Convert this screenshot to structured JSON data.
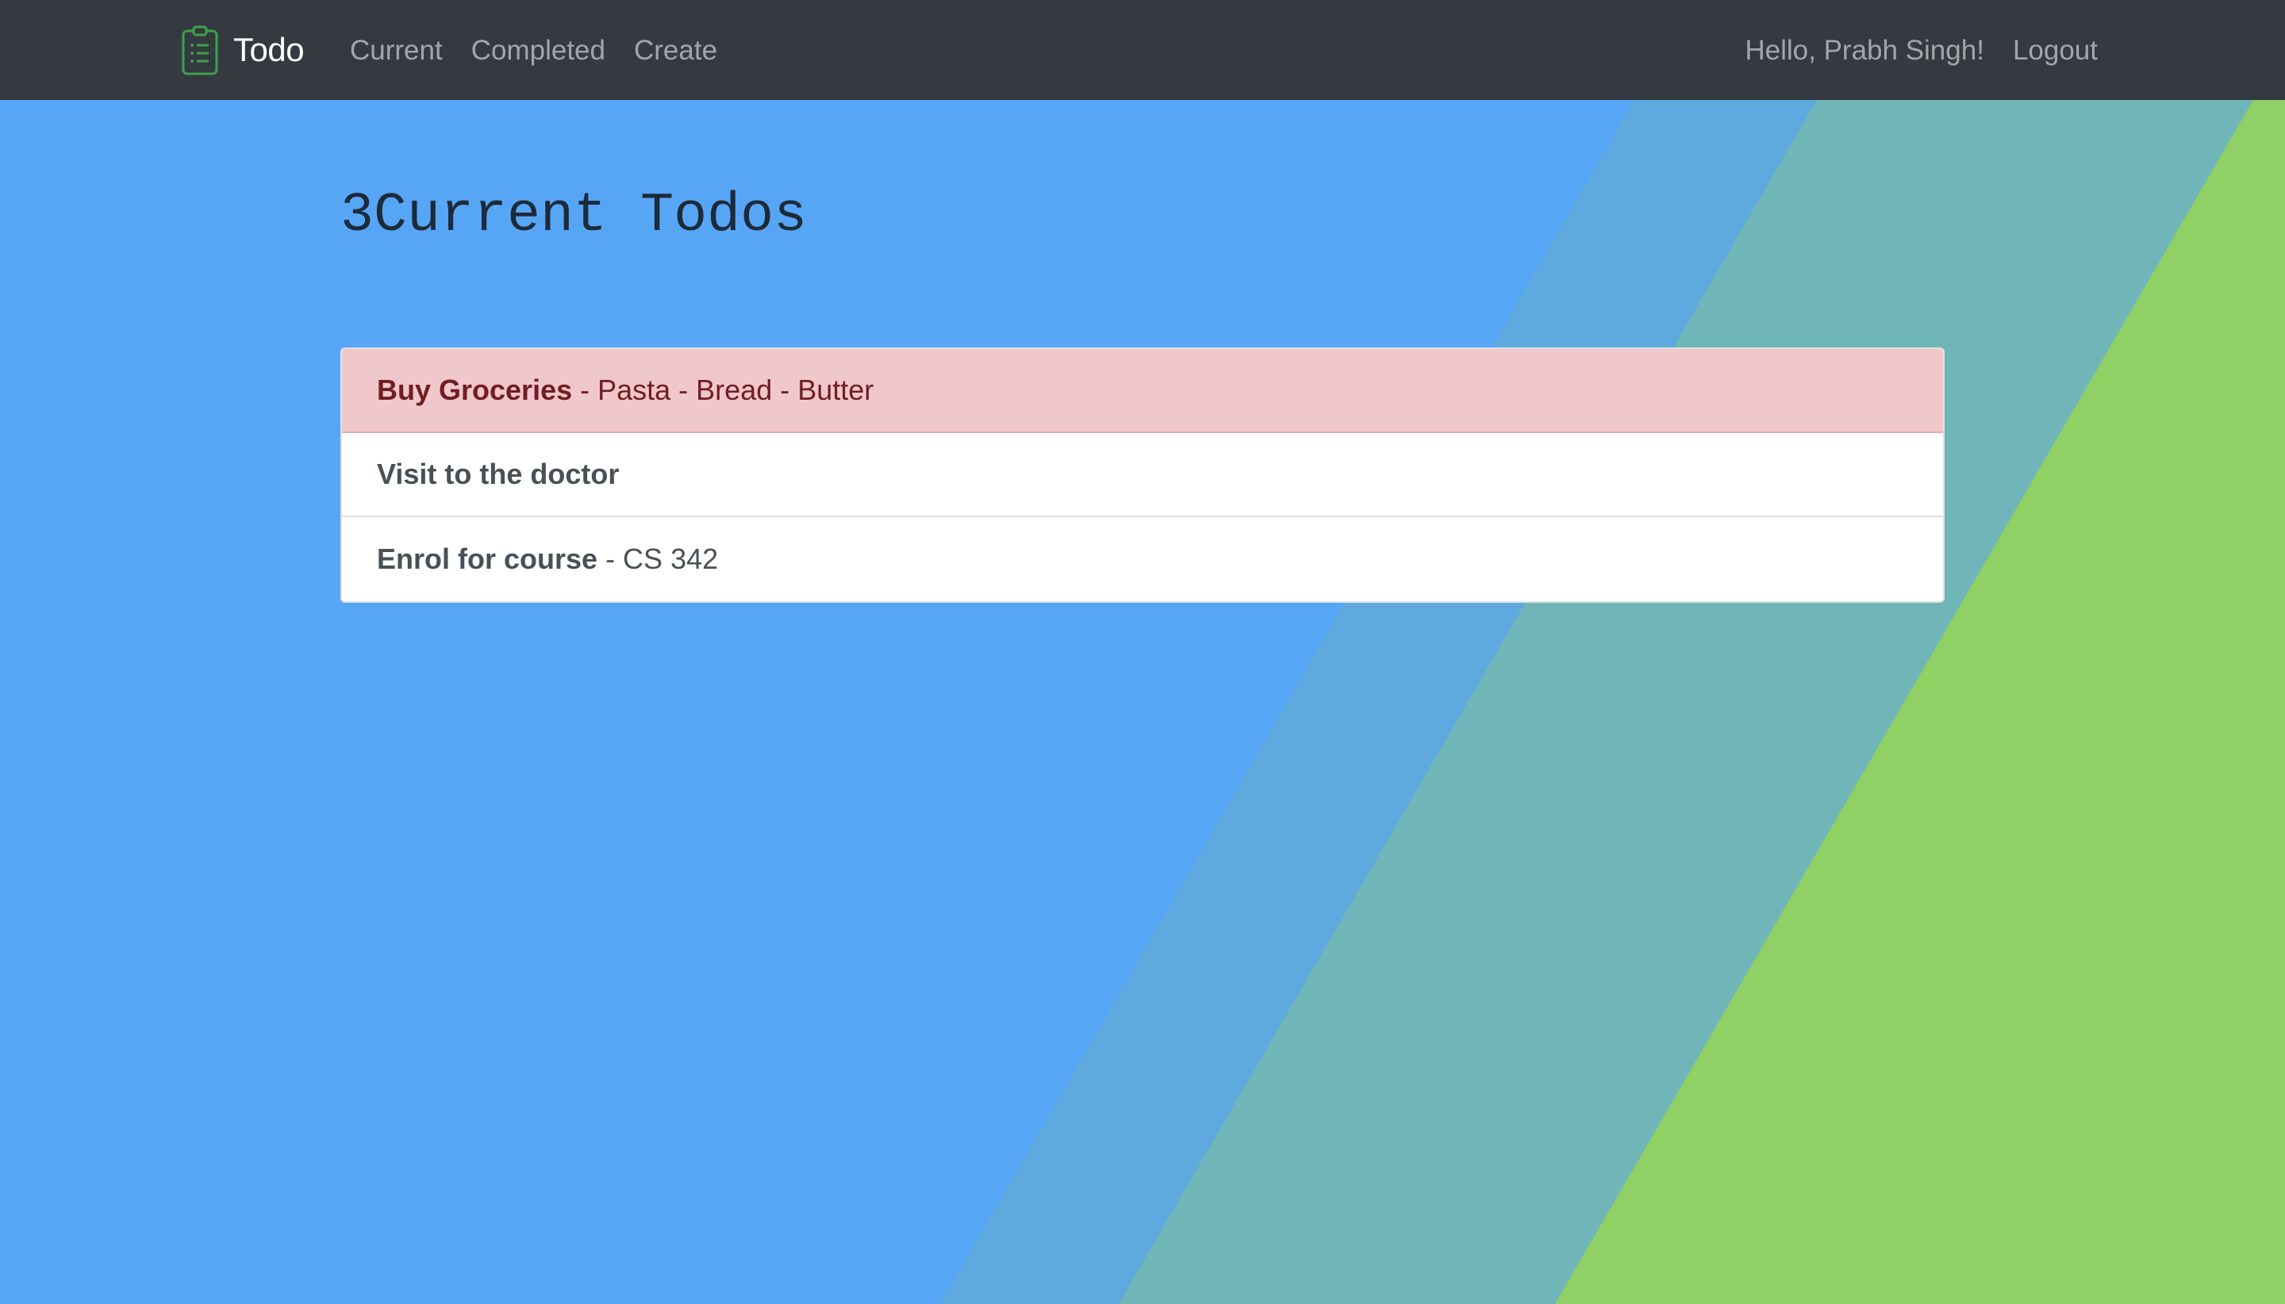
{
  "navbar": {
    "brand_label": "Todo",
    "brand_icon": "clipboard-list-icon",
    "links": [
      {
        "label": "Current"
      },
      {
        "label": "Completed"
      },
      {
        "label": "Create"
      }
    ],
    "greeting": "Hello, Prabh Singh!",
    "logout_label": "Logout"
  },
  "main": {
    "count": "3",
    "title": "Current Todos",
    "todos": [
      {
        "name": "Buy Groceries",
        "detail": " - Pasta - Bread - Butter",
        "style": "danger"
      },
      {
        "name": "Visit to the doctor",
        "detail": "",
        "style": "default"
      },
      {
        "name": "Enrol for course",
        "detail": " - CS 342",
        "style": "default"
      }
    ]
  },
  "colors": {
    "navbar_bg": "#343a40",
    "background_blue": "#57a6f6",
    "band_mid": "#5eaade",
    "band_teal": "#70b6b8",
    "band_green": "#90d064",
    "danger_bg": "#f0c7cb",
    "danger_text": "#721c24",
    "brand_icon_green": "#3fa14a"
  }
}
